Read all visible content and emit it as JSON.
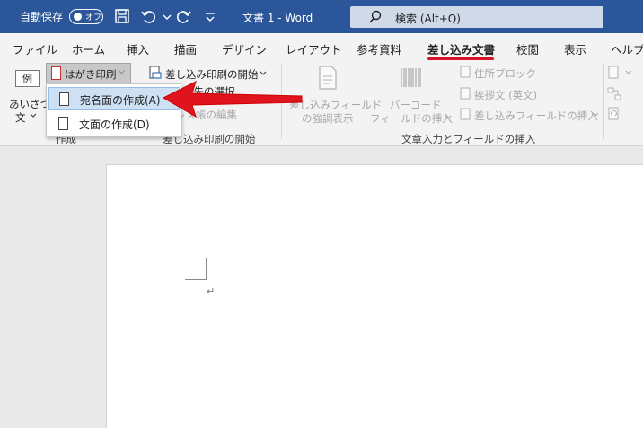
{
  "titlebar": {
    "autosave_label": "自動保存",
    "autosave_state": "オフ",
    "doc_title": "文書 1  -  Word",
    "search_text": "検索 (Alt+Q)",
    "bg_color": "#2b579a"
  },
  "tabs": [
    {
      "label": "ファイル"
    },
    {
      "label": "ホーム"
    },
    {
      "label": "挿入"
    },
    {
      "label": "描画"
    },
    {
      "label": "デザイン"
    },
    {
      "label": "レイアウト"
    },
    {
      "label": "参考資料"
    },
    {
      "label": "差し込み文書",
      "active": true
    },
    {
      "label": "校閲"
    },
    {
      "label": "表示"
    },
    {
      "label": "ヘルプ"
    }
  ],
  "ribbon": {
    "sample_label": "例",
    "greeting_line1": "あいさつ",
    "greeting_line2": "文",
    "hagaki_label": "はがき印刷",
    "mailmerge_start_label": "差し込み印刷の開始",
    "partial_recipients": "宛先の選択",
    "partial_edit": "アドレス帳の編集",
    "group_create": "作成",
    "group_mailmerge": "差し込み印刷の開始",
    "highlight_fields_1": "差し込みフィールド",
    "highlight_fields_2": "の強調表示",
    "barcode_1": "バーコード",
    "barcode_2": "フィールドの挿入",
    "address_block": "住所ブロック",
    "greeting_line": "挨拶文 (英文)",
    "insert_merge_field": "差し込みフィールドの挿入",
    "group_write_insert": "文章入力とフィールドの挿入"
  },
  "dropdown": {
    "items": [
      {
        "label": "宛名面の作成(A)"
      },
      {
        "label": "文面の作成(D)"
      }
    ]
  },
  "document": {
    "paragraph_mark": "↵"
  },
  "colors": {
    "accent_red": "#e0141e",
    "active_underline": "#d8142a"
  }
}
